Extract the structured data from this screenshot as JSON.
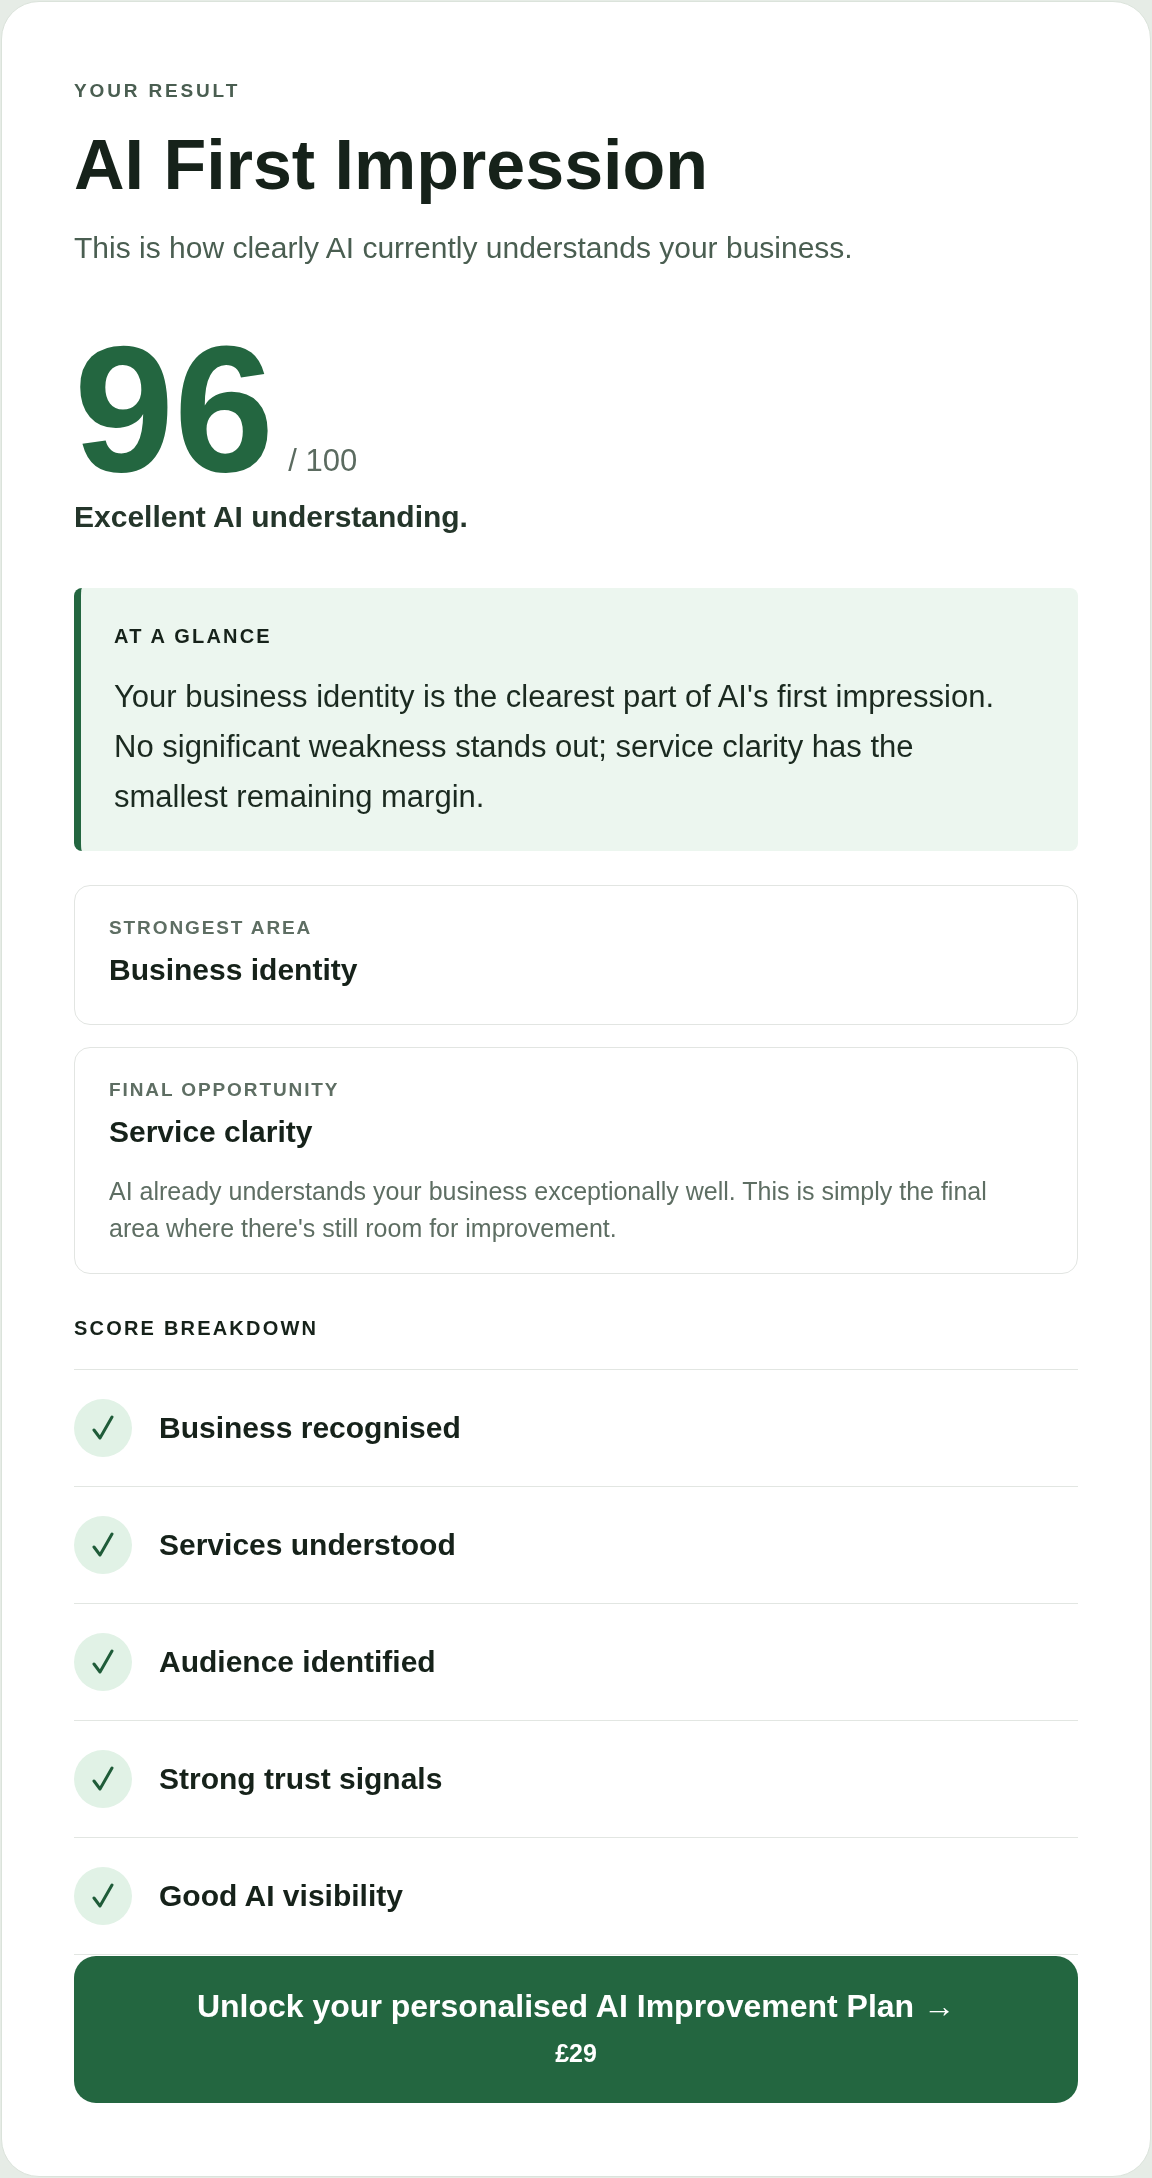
{
  "header": {
    "eyebrow": "YOUR RESULT",
    "title": "AI First Impression",
    "subtitle": "This is how clearly AI currently understands your business."
  },
  "score": {
    "value": "96",
    "max": "/ 100",
    "verdict": "Excellent AI understanding."
  },
  "at_a_glance": {
    "heading": "AT A GLANCE",
    "text": "Your business identity is the clearest part of AI's first impression. No significant weakness stands out; service clarity has the smallest remaining margin."
  },
  "highlights": [
    {
      "label": "STRONGEST AREA",
      "value": "Business identity"
    },
    {
      "label": "FINAL OPPORTUNITY",
      "value": "Service clarity",
      "description": "AI already understands your business exceptionally well. This is simply the final area where there's still room for improvement."
    }
  ],
  "breakdown": {
    "heading": "SCORE BREAKDOWN",
    "items": [
      {
        "label": "Business recognised",
        "checked": true
      },
      {
        "label": "Services understood",
        "checked": true
      },
      {
        "label": "Audience identified",
        "checked": true
      },
      {
        "label": "Strong trust signals",
        "checked": true
      },
      {
        "label": "Good AI visibility",
        "checked": true
      }
    ]
  },
  "cta_button": {
    "label": "Unlock your personalised AI Improvement Plan →",
    "price": "£29"
  }
}
